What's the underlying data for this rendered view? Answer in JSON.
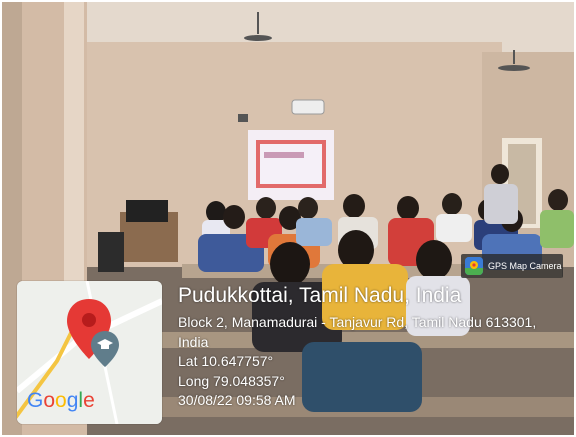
{
  "location": {
    "title": "Pudukkottai, Tamil Nadu, India",
    "address_line_1": "Block 2, Manamadurai - Tanjavur Rd, Tamil Nadu 613301,",
    "address_line_2": "India",
    "latitude": "Lat 10.647757°",
    "longitude": "Long 79.048357°",
    "timestamp": "30/08/22 09:58 AM"
  },
  "badge": {
    "label": "GPS Map Camera",
    "icon": "gps-map-camera-app-icon"
  },
  "map": {
    "provider_logo": [
      "G",
      "o",
      "o",
      "g",
      "l",
      "e"
    ],
    "logo_colors": [
      "#4285F4",
      "#EA4335",
      "#FBBC05",
      "#4285F4",
      "#34A853",
      "#EA4335"
    ],
    "pin_icon": "location-pin-icon",
    "place_icon": "graduation-cap-icon"
  },
  "colors": {
    "pin_red": "#E53935",
    "road_yellow": "#F4C542",
    "wall": "#d9c4b2"
  }
}
